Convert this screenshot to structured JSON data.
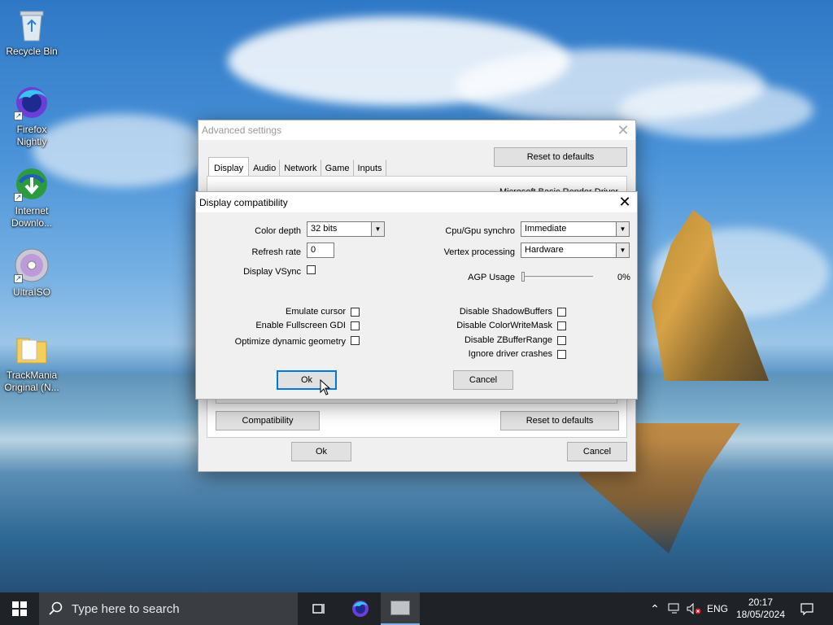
{
  "desktop": {
    "icons": [
      {
        "label": "Recycle Bin"
      },
      {
        "label": "Firefox Nightly"
      },
      {
        "label": "Internet Downlo..."
      },
      {
        "label": "UltraISO"
      },
      {
        "label": "TrackMania Original (N..."
      }
    ]
  },
  "advanced": {
    "title": "Advanced settings",
    "tabs": [
      "Display",
      "Audio",
      "Network",
      "Game",
      "Inputs"
    ],
    "active_tab": "Display",
    "reset_top_label": "Reset to defaults",
    "driver_text": "Microsoft Basic Render Driver",
    "compat_label": "Compatibility",
    "reset_bottom_label": "Reset to defaults",
    "ok_label": "Ok",
    "cancel_label": "Cancel"
  },
  "compat": {
    "title": "Display compatibility",
    "color_depth_label": "Color depth",
    "color_depth_value": "32 bits",
    "refresh_rate_label": "Refresh rate",
    "refresh_rate_value": "0",
    "vsync_label": "Display VSync",
    "cpu_gpu_label": "Cpu/Gpu synchro",
    "cpu_gpu_value": "Immediate",
    "vertex_label": "Vertex processing",
    "vertex_value": "Hardware",
    "agp_label": "AGP Usage",
    "agp_value": "0%",
    "agp_fraction": 0,
    "emulate_cursor_label": "Emulate cursor",
    "fullscreen_gdi_label": "Enable Fullscreen GDI",
    "optimize_geom_label": "Optimize dynamic geometry",
    "shadow_label": "Disable ShadowBuffers",
    "colorwrite_label": "Disable ColorWriteMask",
    "zbuffer_label": "Disable ZBufferRange",
    "ignore_crash_label": "Ignore driver crashes",
    "ok_label": "Ok",
    "cancel_label": "Cancel"
  },
  "taskbar": {
    "search_placeholder": "Type here to search",
    "lang": "ENG",
    "time": "20:17",
    "date": "18/05/2024"
  },
  "colors": {
    "accent": "#0078d7",
    "taskbar": "#1f2327"
  }
}
